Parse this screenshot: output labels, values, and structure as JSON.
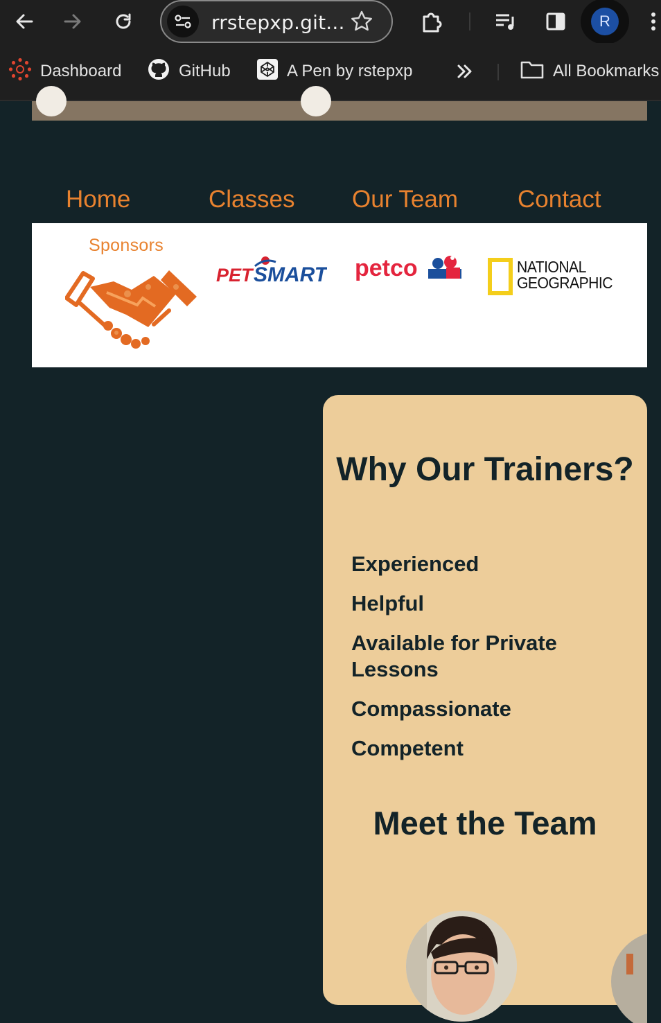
{
  "browser": {
    "url": "rrstepxp.git...",
    "profile_initial": "R",
    "bookmarks": [
      {
        "label": "Dashboard",
        "icon": "canvas-icon"
      },
      {
        "label": "GitHub",
        "icon": "github-icon"
      },
      {
        "label": "A Pen by rstepxp",
        "icon": "codepen-icon"
      }
    ],
    "all_bookmarks_label": "All Bookmarks"
  },
  "nav": {
    "items": [
      "Home",
      "Classes",
      "Our Team",
      "Contact"
    ]
  },
  "sponsors": {
    "title": "Sponsors",
    "logos": [
      {
        "name": "PetSmart",
        "icon": "petsmart-logo"
      },
      {
        "name": "petco",
        "icon": "petco-logo"
      },
      {
        "name": "National Geographic",
        "line1": "NATIONAL",
        "line2": "GEOGRAPHIC",
        "icon": "natgeo-logo"
      }
    ]
  },
  "why": {
    "title": "Why Our Trainers?",
    "qualities": [
      "Experienced",
      "Helpful",
      "Available for Private Lessons",
      "Compassionate",
      "Competent"
    ]
  },
  "team": {
    "title": "Meet the Team"
  },
  "colors": {
    "page_bg": "#132328",
    "accent_orange": "#e8822f",
    "card_bg": "#edcd9a",
    "chrome_bg": "#1f1f1f"
  }
}
